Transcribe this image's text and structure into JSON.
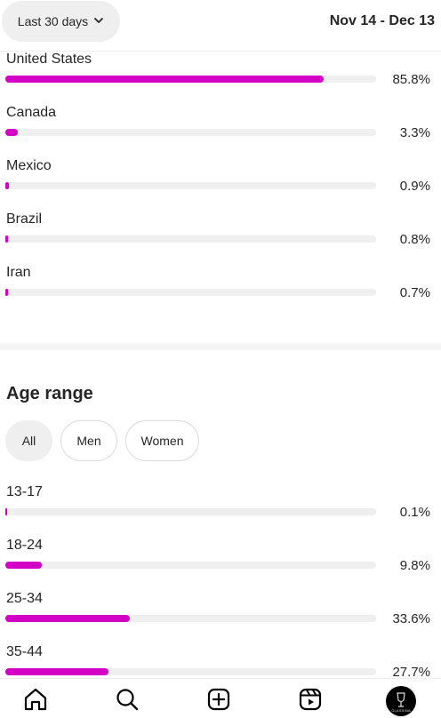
{
  "header": {
    "range_label": "Last 30 days",
    "dates": "Nov 14 - Dec 13"
  },
  "countries": [
    {
      "name": "United States",
      "percent_label": "85.8%",
      "value": 85.8
    },
    {
      "name": "Canada",
      "percent_label": "3.3%",
      "value": 3.3
    },
    {
      "name": "Mexico",
      "percent_label": "0.9%",
      "value": 0.9
    },
    {
      "name": "Brazil",
      "percent_label": "0.8%",
      "value": 0.8
    },
    {
      "name": "Iran",
      "percent_label": "0.7%",
      "value": 0.7
    }
  ],
  "age_section": {
    "title": "Age range",
    "filters": [
      {
        "label": "All",
        "selected": true
      },
      {
        "label": "Men",
        "selected": false
      },
      {
        "label": "Women",
        "selected": false
      }
    ],
    "ranges": [
      {
        "name": "13-17",
        "percent_label": "0.1%",
        "value": 0.1
      },
      {
        "name": "18-24",
        "percent_label": "9.8%",
        "value": 9.8
      },
      {
        "name": "25-34",
        "percent_label": "33.6%",
        "value": 33.6
      },
      {
        "name": "35-44",
        "percent_label": "27.7%",
        "value": 27.7
      }
    ]
  },
  "bar_color": "#d300c5",
  "nav": {
    "items": [
      "home-icon",
      "search-icon",
      "create-icon",
      "reels-icon",
      "profile-avatar"
    ],
    "avatar_text": "GLASSINA"
  }
}
